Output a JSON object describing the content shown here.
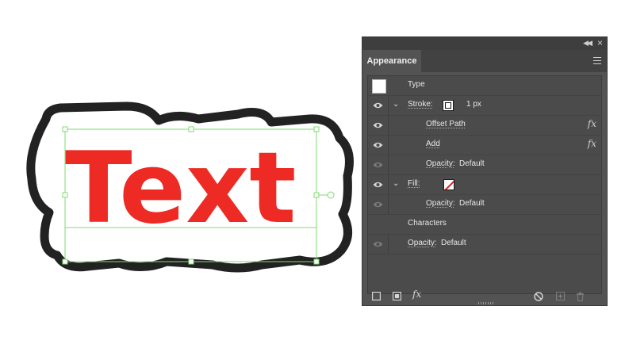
{
  "canvas": {
    "artwork_text": "Text",
    "text_color": "#ee2a24",
    "outline_color": "#222222",
    "selection_color": "#7ddc6e"
  },
  "panel": {
    "tab_label": "Appearance",
    "rows": {
      "type": {
        "label": "Type"
      },
      "stroke": {
        "label": "Stroke:",
        "value": "1 px"
      },
      "offset_path": {
        "label": "Offset Path"
      },
      "add": {
        "label": "Add"
      },
      "opacity1": {
        "label": "Opacity:",
        "value": "Default"
      },
      "fill": {
        "label": "Fill:"
      },
      "opacity2": {
        "label": "Opacity:",
        "value": "Default"
      },
      "characters": {
        "label": "Characters"
      },
      "opacity3": {
        "label": "Opacity:",
        "value": "Default"
      }
    },
    "fx_label": "fx",
    "icons": [
      "collapse-icon",
      "close-icon",
      "panel-menu-icon",
      "eye-icon",
      "chevron-down-icon",
      "fx-icon",
      "add-new-stroke-icon",
      "add-new-fill-icon",
      "add-new-effect-icon",
      "clear-appearance-icon",
      "duplicate-item-icon",
      "delete-item-icon"
    ]
  }
}
